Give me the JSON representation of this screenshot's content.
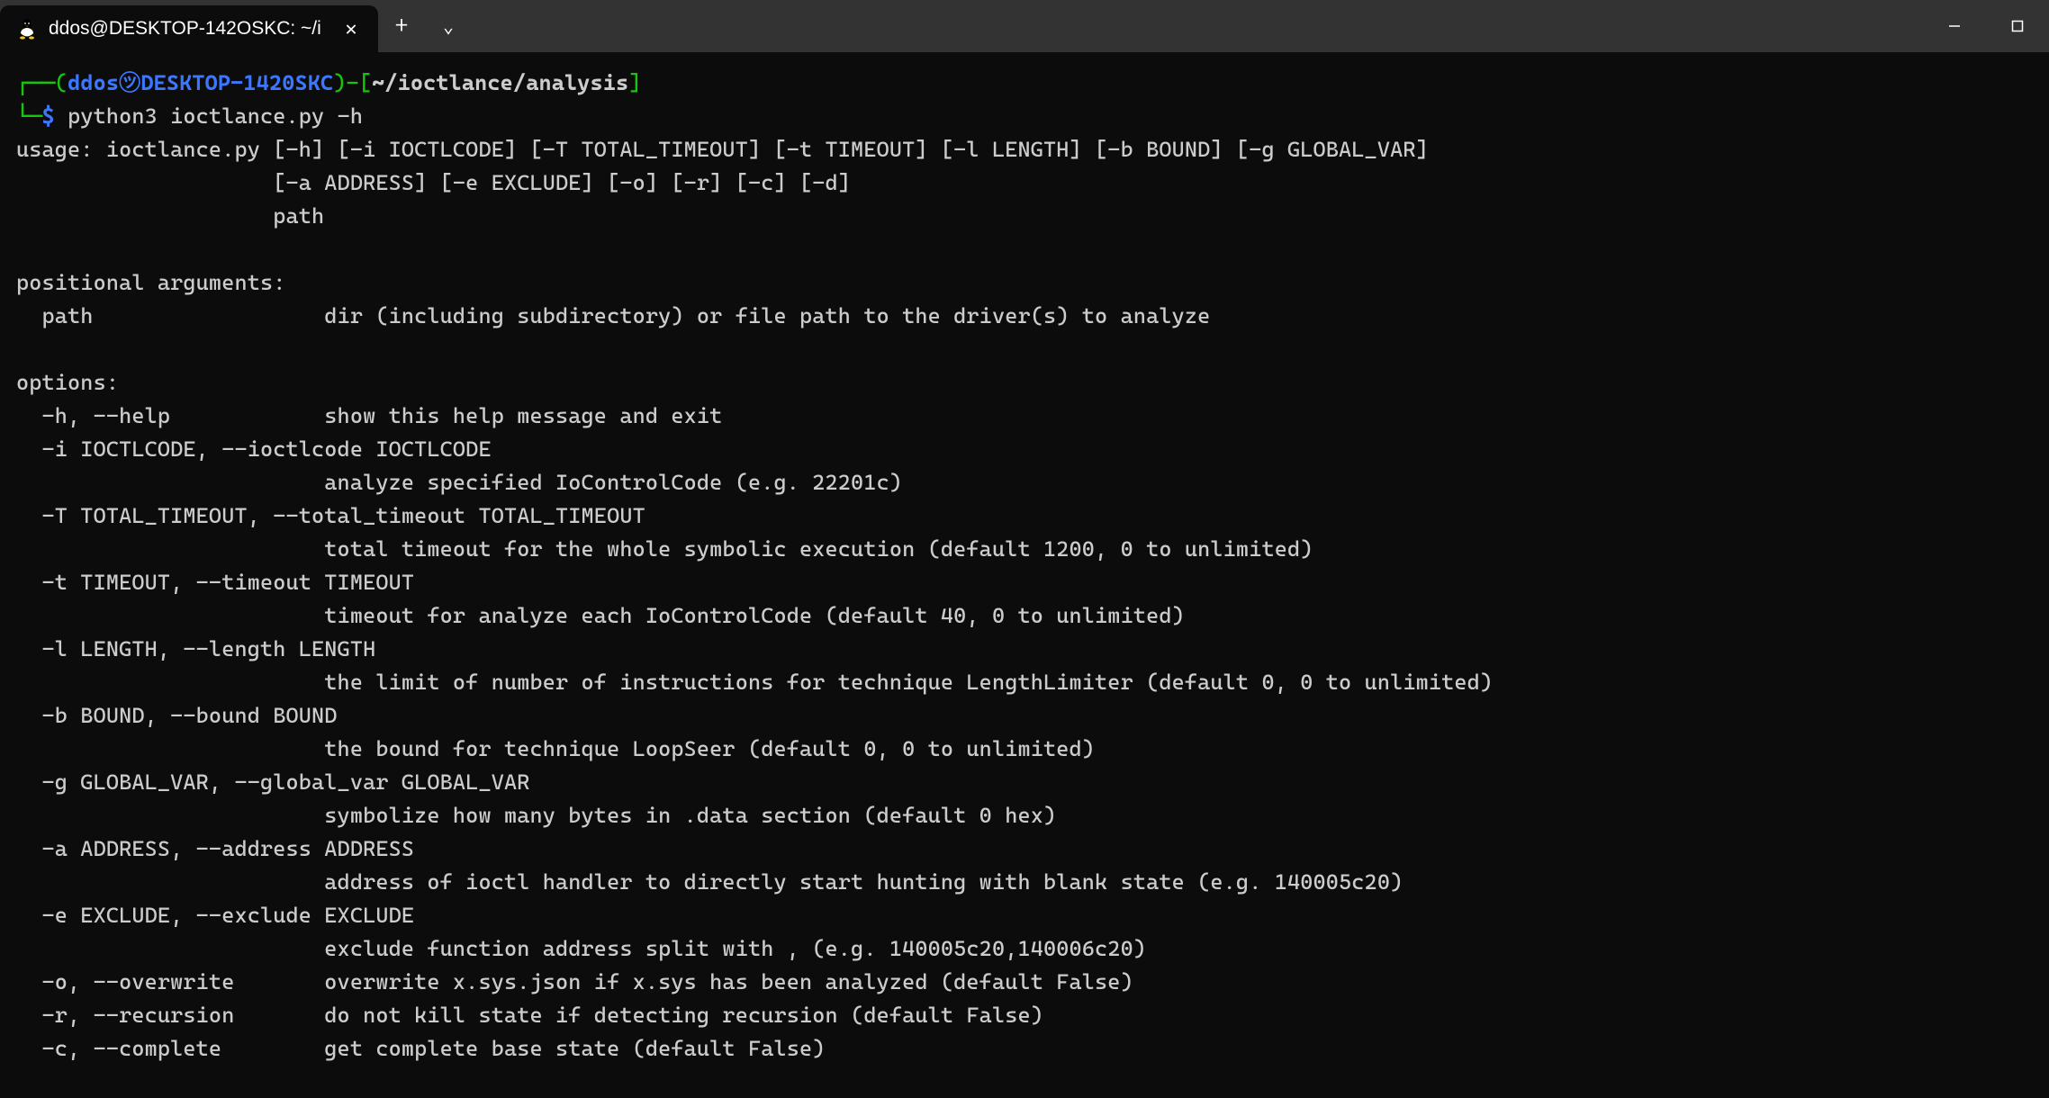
{
  "titlebar": {
    "tab_title": "ddos@DESKTOP-142OSKC: ~/i",
    "new_tab_glyph": "+",
    "dropdown_glyph": "⌄",
    "close_glyph": "✕",
    "min_glyph": "—",
    "max_glyph": "▢"
  },
  "prompt": {
    "open": "┌──(",
    "user": "ddos",
    "at": "㋡",
    "host": "DESKTOP-1420SKC",
    "close_paren": ")",
    "sep": "-",
    "path_open": "[",
    "path": "~/ioctlance/analysis",
    "path_close": "]",
    "line2_lead": "└─",
    "dollar": "$",
    "command": "python3 ioctlance.py -h"
  },
  "output": {
    "l01": "usage: ioctlance.py [-h] [-i IOCTLCODE] [-T TOTAL_TIMEOUT] [-t TIMEOUT] [-l LENGTH] [-b BOUND] [-g GLOBAL_VAR]",
    "l02": "                    [-a ADDRESS] [-e EXCLUDE] [-o] [-r] [-c] [-d]",
    "l03": "                    path",
    "l04": "",
    "l05": "positional arguments:",
    "l06": "  path                  dir (including subdirectory) or file path to the driver(s) to analyze",
    "l07": "",
    "l08": "options:",
    "l09": "  -h, --help            show this help message and exit",
    "l10": "  -i IOCTLCODE, --ioctlcode IOCTLCODE",
    "l11": "                        analyze specified IoControlCode (e.g. 22201c)",
    "l12": "  -T TOTAL_TIMEOUT, --total_timeout TOTAL_TIMEOUT",
    "l13": "                        total timeout for the whole symbolic execution (default 1200, 0 to unlimited)",
    "l14": "  -t TIMEOUT, --timeout TIMEOUT",
    "l15": "                        timeout for analyze each IoControlCode (default 40, 0 to unlimited)",
    "l16": "  -l LENGTH, --length LENGTH",
    "l17": "                        the limit of number of instructions for technique LengthLimiter (default 0, 0 to unlimited)",
    "l18": "  -b BOUND, --bound BOUND",
    "l19": "                        the bound for technique LoopSeer (default 0, 0 to unlimited)",
    "l20": "  -g GLOBAL_VAR, --global_var GLOBAL_VAR",
    "l21": "                        symbolize how many bytes in .data section (default 0 hex)",
    "l22": "  -a ADDRESS, --address ADDRESS",
    "l23": "                        address of ioctl handler to directly start hunting with blank state (e.g. 140005c20)",
    "l24": "  -e EXCLUDE, --exclude EXCLUDE",
    "l25": "                        exclude function address split with , (e.g. 140005c20,140006c20)",
    "l26": "  -o, --overwrite       overwrite x.sys.json if x.sys has been analyzed (default False)",
    "l27": "  -r, --recursion       do not kill state if detecting recursion (default False)",
    "l28": "  -c, --complete        get complete base state (default False)"
  }
}
